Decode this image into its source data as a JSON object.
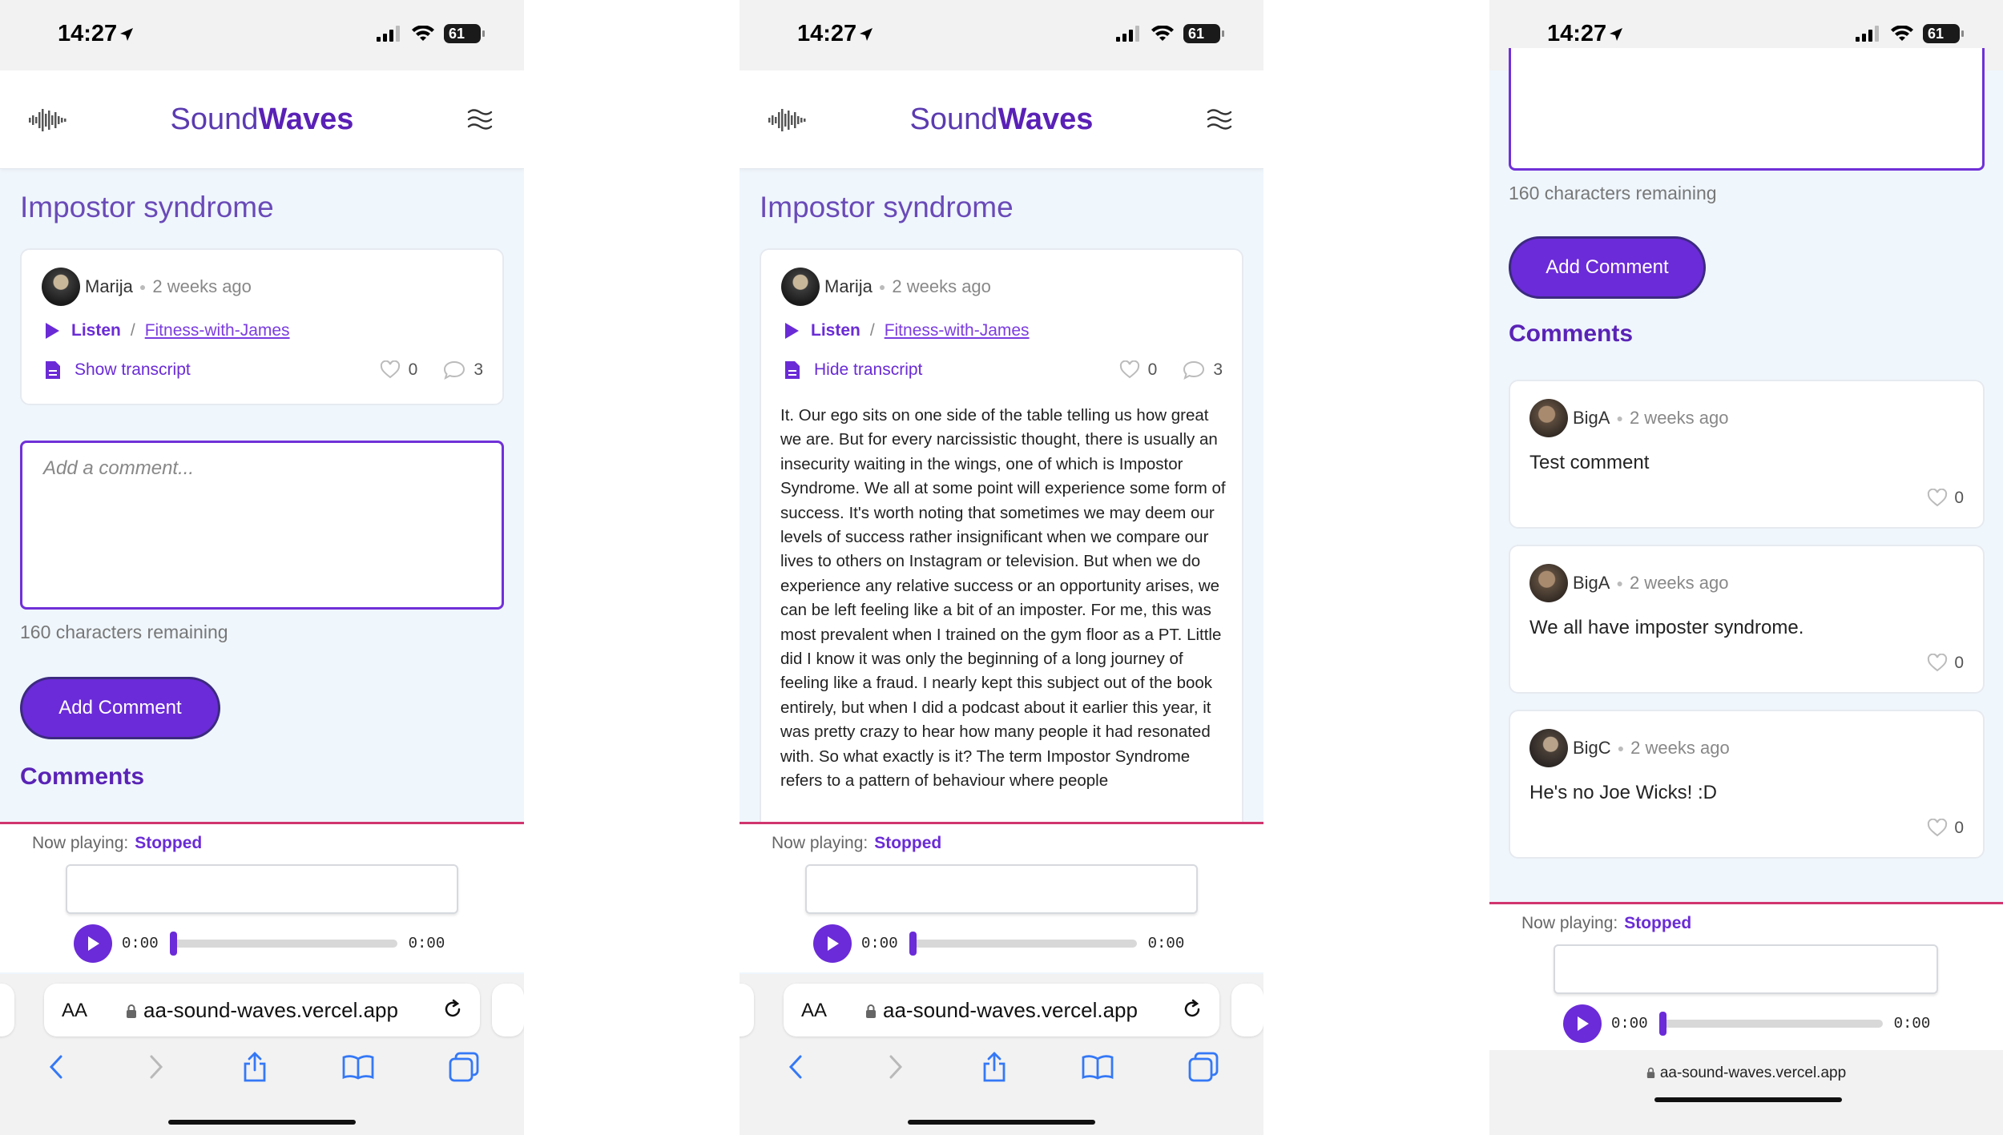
{
  "status": {
    "time": "14:27",
    "battery": "61"
  },
  "app": {
    "logo_sound": "Sound",
    "logo_waves": "Waves"
  },
  "post": {
    "title": "Impostor syndrome",
    "author": "Marija",
    "time_ago": "2 weeks ago",
    "listen_label": "Listen",
    "separator": "/",
    "category": "Fitness-with-James",
    "show_transcript": "Show transcript",
    "hide_transcript": "Hide transcript",
    "likes": "0",
    "comments_count": "3",
    "transcript": "It. Our ego sits on one side of the table telling us how great we are. But for every narcissistic thought, there is usually an insecurity waiting in the wings, one of which is Impostor Syndrome. We all at some point will experience some form of success. It's worth noting that sometimes we may deem our levels of success rather insignificant when we compare our lives to others on Instagram or television. But when we do experience any relative success or an opportunity arises, we can be left feeling like a bit of an imposter. For me, this was most prevalent when I trained on the gym floor as a PT. Little did I know it was only the beginning of a long journey of feeling like a fraud. I nearly kept this subject out of the book entirely, but when I did a podcast about it earlier this year, it was pretty crazy to hear how many people it had resonated with. So what exactly is it? The term Impostor Syndrome refers to a pattern of behaviour where people"
  },
  "comment_form": {
    "placeholder": "Add a comment...",
    "chars_remaining": "160 characters remaining",
    "add_button": "Add Comment",
    "heading": "Comments"
  },
  "comments": [
    {
      "author": "BigA",
      "time_ago": "2 weeks ago",
      "text": "Test comment",
      "likes": "0"
    },
    {
      "author": "BigA",
      "time_ago": "2 weeks ago",
      "text": "We all have imposter syndrome.",
      "likes": "0"
    },
    {
      "author": "BigC",
      "time_ago": "2 weeks ago",
      "text": "He's no Joe Wicks! :D",
      "likes": "0"
    }
  ],
  "player": {
    "now_playing_label": "Now playing:",
    "state": "Stopped",
    "current_time": "0:00",
    "duration": "0:00",
    "progress": 0
  },
  "browser": {
    "aa": "AA",
    "url": "aa-sound-waves.vercel.app"
  },
  "colors": {
    "accent": "#6b2bd8",
    "player_border": "#d0356e",
    "page_bg": "#eff6fc"
  }
}
